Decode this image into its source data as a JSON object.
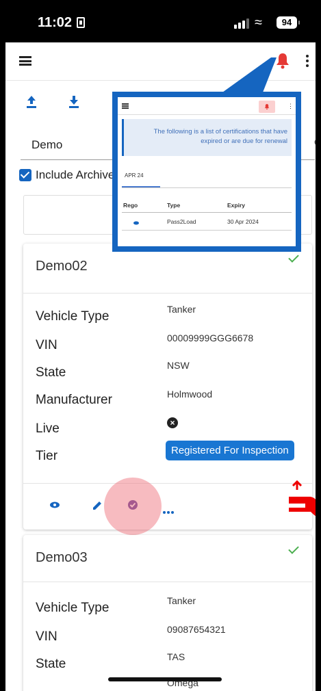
{
  "status": {
    "time": "11:02",
    "battery": "94"
  },
  "filter": {
    "search_value": "Demo",
    "include_archived_label": "Include Archive"
  },
  "popup": {
    "banner_text": "The following is a list of certifications that have expired or are due for renewal",
    "tab_label": "APR 24",
    "columns": [
      "Rego",
      "Type",
      "Expiry"
    ],
    "row": {
      "type": "Pass2Load",
      "expiry": "30 Apr 2024"
    }
  },
  "cards": [
    {
      "title": "Demo02",
      "labels": [
        "Vehicle Type",
        "VIN",
        "State",
        "Manufacturer",
        "Live",
        "Tier"
      ],
      "vehicle_type": "Tanker",
      "vin": "00009999GGG6678",
      "state": "NSW",
      "manufacturer": "Holmwood",
      "tier": "Registered For Inspection"
    },
    {
      "title": "Demo03",
      "labels": [
        "Vehicle Type",
        "VIN",
        "State"
      ],
      "vehicle_type": "Tanker",
      "vin": "09087654321",
      "state": "TAS",
      "manufacturer": "Omega"
    }
  ],
  "colors": {
    "primary": "#1976d2",
    "bell": "#e53935",
    "check": "#4caf50",
    "highlight": "#1565c0"
  }
}
